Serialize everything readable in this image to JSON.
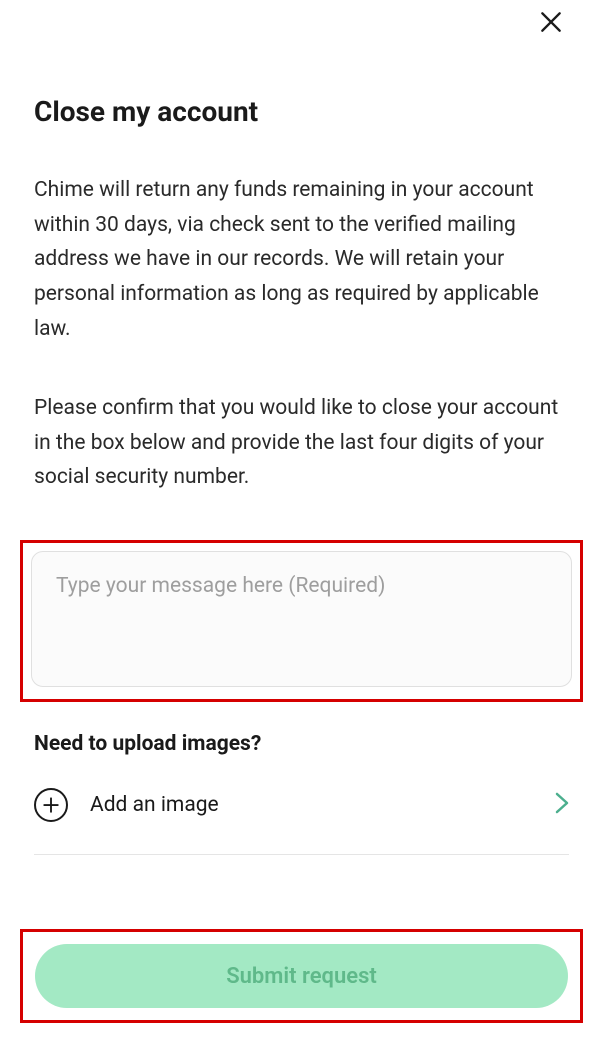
{
  "header": {
    "title": "Close my account"
  },
  "body": {
    "paragraph1": "Chime will return any funds remaining in your account within 30 days, via check sent to the verified mailing address we have in our records. We will retain your personal information as long as required by applicable law.",
    "paragraph2": "Please confirm that you would like to close your account in the box below and provide the last four digits of your social security number."
  },
  "message": {
    "placeholder": "Type your message here (Required)",
    "value": ""
  },
  "upload": {
    "heading": "Need to upload images?",
    "add_label": "Add an image"
  },
  "actions": {
    "submit_label": "Submit request"
  },
  "colors": {
    "highlight_border": "#d50000",
    "button_bg": "#a3e9c4",
    "button_text": "#5fb98a",
    "chevron": "#4caf8e"
  }
}
